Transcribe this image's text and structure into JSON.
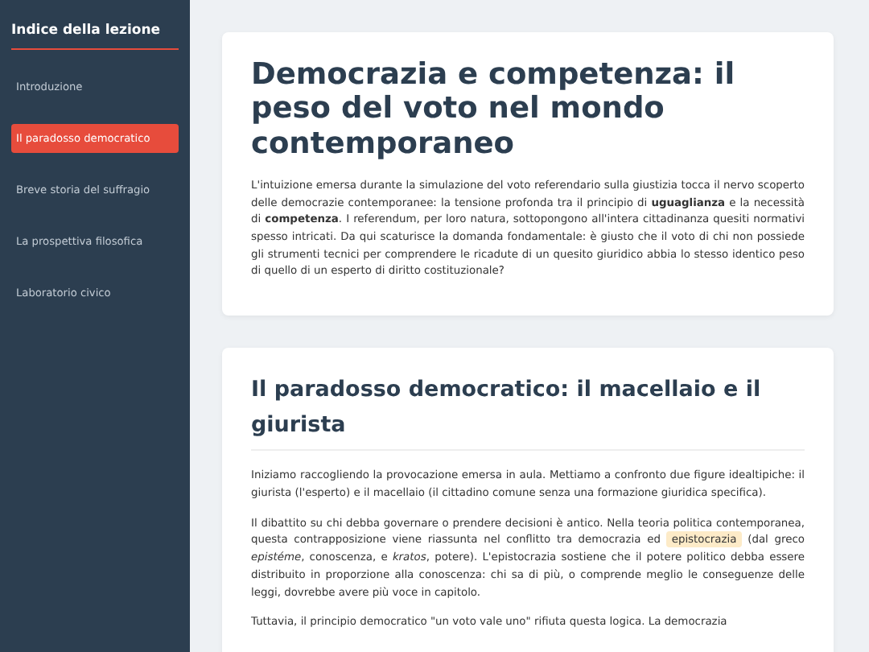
{
  "sidebar": {
    "title": "Indice della lezione",
    "items": [
      {
        "label": "Introduzione",
        "selected": false
      },
      {
        "label": "Il paradosso democratico",
        "selected": true
      },
      {
        "label": "Breve storia del suffragio",
        "selected": false
      },
      {
        "label": "La prospettiva filosofica",
        "selected": false
      },
      {
        "label": "Laboratorio civico",
        "selected": false
      }
    ]
  },
  "sections": [
    {
      "kind": "intro",
      "heading": "Democrazia e competenza: il peso del voto nel mondo contemporaneo",
      "paragraphs": [
        [
          {
            "kind": "text",
            "text": "L'intuizione emersa durante la simulazione del voto referendario sulla giustizia tocca il nervo scoperto delle democrazie contemporanee: la tensione profonda tra il principio di **uguaglianza** e la necessità di **competenza**. I referendum, per loro natura, sottopongono all'intera cittadinanza quesiti normativi spesso intricati. Da qui scaturisce la domanda fondamentale: è giusto che il voto di chi non possiede gli strumenti tecnici per comprendere le ricadute di un quesito giuridico abbia lo stesso identico peso di quello di un esperto di diritto costituzionale?"
          }
        ]
      ]
    },
    {
      "kind": "section",
      "heading": "Il paradosso democratico: il macellaio e il giurista",
      "paragraphs": [
        [
          {
            "kind": "text",
            "text": "Iniziamo raccogliendo la provocazione emersa in aula. Mettiamo a confronto due figure idealtipiche: il giurista (l'esperto) e il macellaio (il cittadino comune senza una formazione giuridica specifica)."
          }
        ],
        [
          {
            "kind": "text",
            "text": "Il dibattito su chi debba governare o prendere decisioni è antico. Nella teoria politica contemporanea, questa contrapposizione viene riassunta nel conflitto tra democrazia ed "
          },
          {
            "kind": "term",
            "text": "epistocrazia"
          },
          {
            "kind": "text",
            "text": " (dal greco *epistéme*, conoscenza, e *kratos*, potere). L'epistocrazia sostiene che il potere politico debba essere distribuito in proporzione alla conoscenza: chi sa di più, o comprende meglio le conseguenze delle leggi, dovrebbe avere più voce in capitolo."
          }
        ],
        [
          {
            "kind": "text",
            "text": "Tuttavia, il principio democratico \"un voto vale uno\" rifiuta questa logica. La democrazia"
          }
        ]
      ]
    }
  ]
}
